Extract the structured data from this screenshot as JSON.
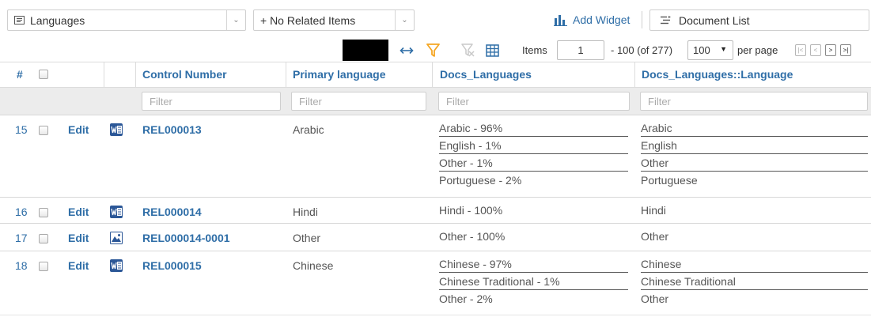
{
  "topbar": {
    "layout_select": "Languages",
    "related_select": "+ No Related Items",
    "add_widget": "Add Widget",
    "doc_list": "Document List"
  },
  "toolbar": {
    "items_label": "Items",
    "items_value": "1",
    "range_text": "- 100 (of 277)",
    "per_page_value": "100",
    "per_page_label": "per page"
  },
  "colors": {
    "link": "#2f6ea7",
    "filter_bg": "#ececec",
    "funnel": "#f5a623"
  },
  "grid": {
    "headers": {
      "num": "#",
      "control_number": "Control Number",
      "primary_language": "Primary language",
      "docs_languages": "Docs_Languages",
      "docs_languages_language": "Docs_Languages::Language"
    },
    "filter_placeholder": "Filter",
    "edit_label": "Edit",
    "rows": [
      {
        "num": "15",
        "icon": "word-doc-icon",
        "control": "REL000013",
        "primary": "Arabic",
        "docs_languages": [
          "Arabic - 96%",
          "English - 1%",
          "Other - 1%",
          "Portuguese - 2%"
        ],
        "languages": [
          "Arabic",
          "English",
          "Other",
          "Portuguese"
        ]
      },
      {
        "num": "16",
        "icon": "word-doc-icon",
        "control": "REL000014",
        "primary": "Hindi",
        "docs_languages": [
          "Hindi - 100%"
        ],
        "languages": [
          "Hindi"
        ]
      },
      {
        "num": "17",
        "icon": "image-icon",
        "control": "REL000014-0001",
        "primary": "Other",
        "docs_languages": [
          "Other - 100%"
        ],
        "languages": [
          "Other"
        ]
      },
      {
        "num": "18",
        "icon": "word-doc-icon",
        "control": "REL000015",
        "primary": "Chinese",
        "docs_languages": [
          "Chinese - 97%",
          "Chinese Traditional - 1%",
          "Other - 2%"
        ],
        "languages": [
          "Chinese",
          "Chinese Traditional",
          "Other"
        ]
      }
    ]
  }
}
